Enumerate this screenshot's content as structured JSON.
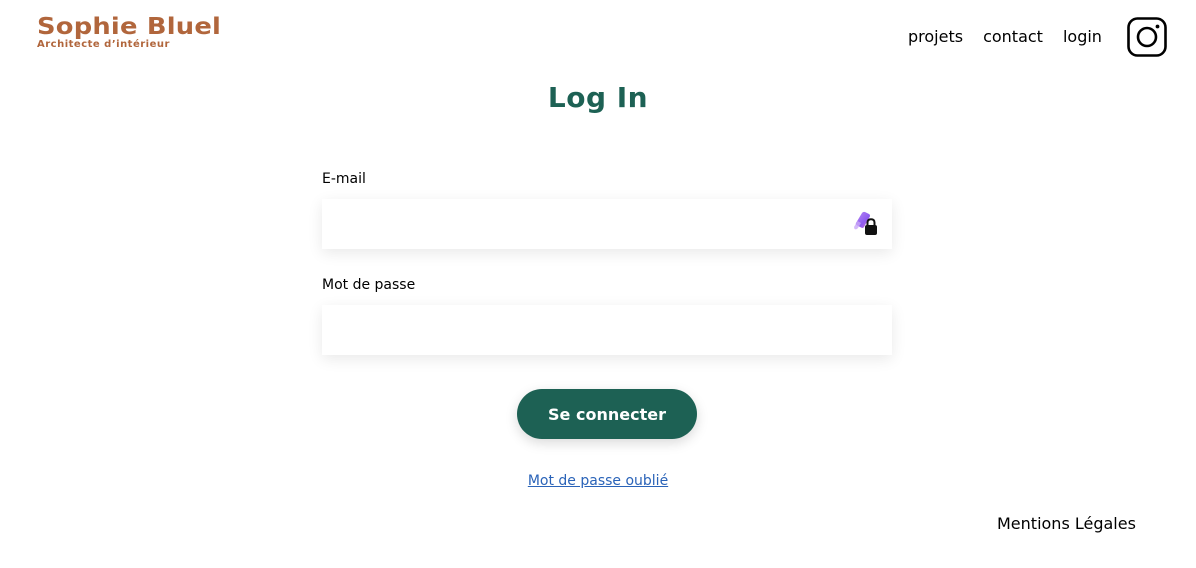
{
  "header": {
    "brand_name": "Sophie Bluel",
    "brand_tagline": "Architecte d’intérieur",
    "nav": [
      {
        "label": "projets"
      },
      {
        "label": "contact"
      },
      {
        "label": "login"
      }
    ],
    "social_icon": "instagram-icon"
  },
  "login": {
    "title": "Log In",
    "email_label": "E-mail",
    "email_value": "",
    "password_label": "Mot de passe",
    "password_value": "",
    "password_manager_icon": "password-manager-lock-icon",
    "submit_label": "Se connecter",
    "forgot_link": "Mot de passe oublié"
  },
  "footer": {
    "legal": "Mentions Légales"
  },
  "colors": {
    "brand": "#B1663C",
    "primary": "#1D6154",
    "link": "#2A63B8"
  }
}
